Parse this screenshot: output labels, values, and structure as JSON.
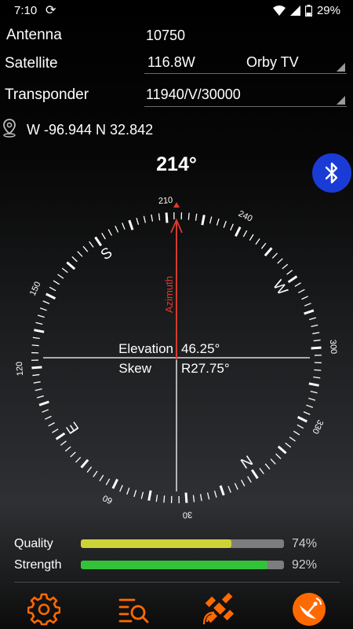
{
  "status_bar": {
    "time": "7:10",
    "sync_icon": "sync-icon",
    "battery": "29%"
  },
  "fields": {
    "antenna_label": "Antenna",
    "antenna_value": "10750",
    "satellite_label": "Satellite",
    "satellite_value": "116.8W",
    "satellite_provider": "Orby TV",
    "transponder_label": "Transponder",
    "transponder_value": "11940/V/30000"
  },
  "location": {
    "coordinates": "W -96.944 N 32.842"
  },
  "compass": {
    "heading": "214°",
    "azimuth_label": "Azimuth",
    "elevation_label": "Elevation",
    "elevation_value": "46.25°",
    "skew_label": "Skew",
    "skew_value": "R27.75°",
    "degree_labels": [
      "210",
      "240",
      "300",
      "330",
      "30",
      "60",
      "120",
      "150"
    ],
    "cardinals": [
      "S",
      "W",
      "N",
      "E"
    ]
  },
  "signal": {
    "quality_label": "Quality",
    "quality_value": "74%",
    "quality_fraction": 0.74,
    "strength_label": "Strength",
    "strength_value": "92%",
    "strength_fraction": 0.92
  },
  "colors": {
    "quality_bar": "#cdd336",
    "strength_bar": "#33c33a",
    "accent": "#ff6a00",
    "azimuth": "#e0392d",
    "bluetooth": "#1b3bd6"
  },
  "nav": {
    "icons": [
      "settings-icon",
      "search-list-icon",
      "satellite-icon",
      "dish-app-icon"
    ]
  }
}
